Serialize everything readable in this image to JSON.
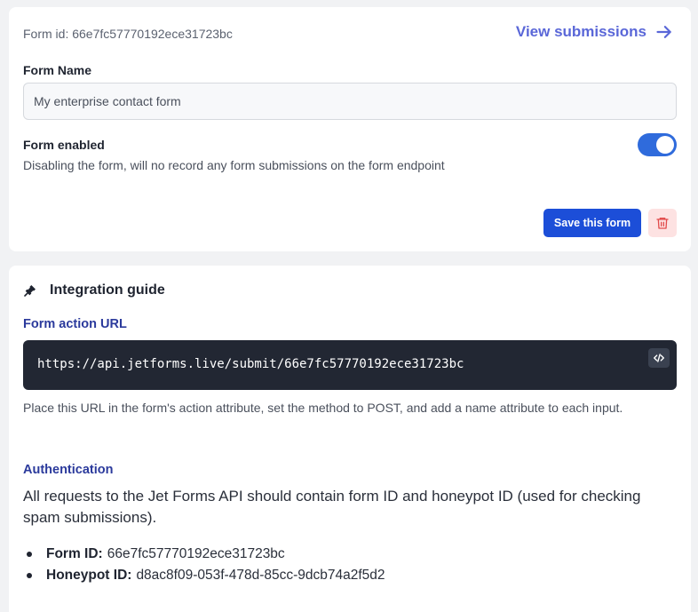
{
  "settings": {
    "form_id_text": "Form id: 66e7fc57770192ece31723bc",
    "view_submissions_label": "View submissions",
    "form_name_label": "Form Name",
    "form_name_value": "My enterprise contact form",
    "enabled_label": "Form enabled",
    "enabled_help": "Disabling the form, will no record any form submissions on the form endpoint",
    "enabled": true,
    "save_label": "Save this form"
  },
  "guide": {
    "title": "Integration guide",
    "action_label": "Form action URL",
    "action_url": "https://api.jetforms.live/submit/66e7fc57770192ece31723bc",
    "action_help": "Place this URL in the form's action attribute, set the method to POST, and add a name attribute to each input.",
    "auth_label": "Authentication",
    "auth_desc": "All requests to the Jet Forms API should contain form ID and honeypot ID (used for checking spam submissions).",
    "ids": [
      {
        "key": "Form ID:",
        "value": "66e7fc57770192ece31723bc"
      },
      {
        "key": "Honeypot ID:",
        "value": "d8ac8f09-053f-478d-85cc-9dcb74a2f5d2"
      }
    ]
  },
  "icons": {
    "view_submissions": "arrow-right-icon",
    "delete": "trash-icon",
    "guide": "plug-icon",
    "code": "code-icon"
  },
  "colors": {
    "accent": "#5a67d8",
    "primary_button": "#1c4ed8",
    "toggle_on": "#2f6bdc",
    "section_label": "#2b3a9c",
    "code_bg": "#222733",
    "danger": "#e24b4b",
    "danger_bg": "#fde2e2"
  }
}
